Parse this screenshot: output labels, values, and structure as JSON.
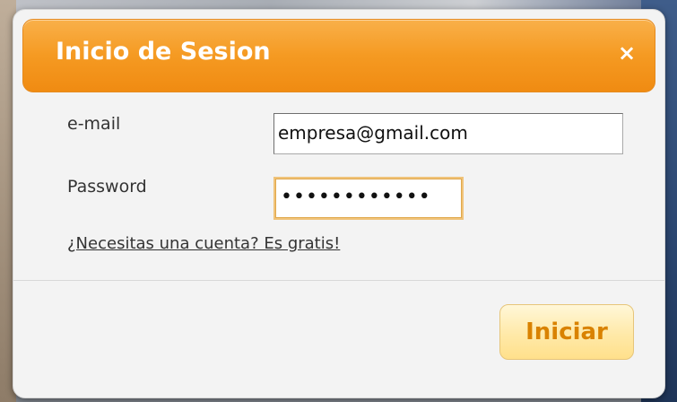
{
  "dialog": {
    "title": "Inicio de Sesion",
    "close_icon": "close-icon",
    "close_glyph": "×"
  },
  "form": {
    "email_label": "e-mail",
    "email_value": "empresa@gmail.com",
    "password_label": "Password",
    "password_masked": "••••••••••••",
    "signup_link": "¿Necesitas una cuenta? Es gratis!",
    "submit_label": "Iniciar"
  },
  "colors": {
    "header": "#f59a22",
    "button_text": "#d98200",
    "button_bg": "#ffe9a8"
  }
}
